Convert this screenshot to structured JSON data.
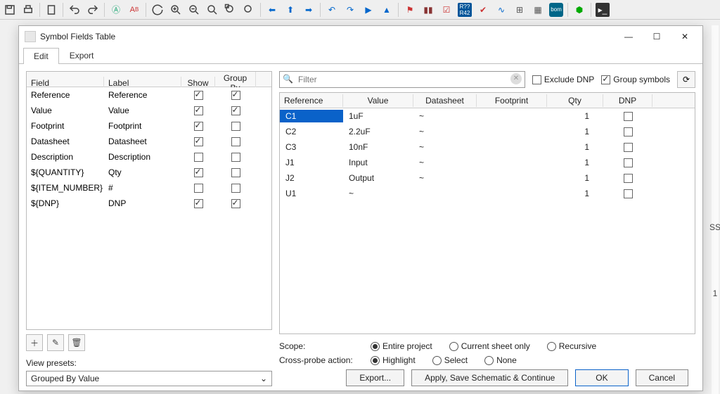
{
  "dialog": {
    "title": "Symbol Fields Table",
    "tabs": {
      "edit": "Edit",
      "export": "Export"
    }
  },
  "fields": {
    "headers": {
      "field": "Field",
      "label": "Label",
      "show": "Show",
      "groupby": "Group By"
    },
    "rows": [
      {
        "field": "Reference",
        "label": "Reference",
        "show": true,
        "group": true
      },
      {
        "field": "Value",
        "label": "Value",
        "show": true,
        "group": true
      },
      {
        "field": "Footprint",
        "label": "Footprint",
        "show": true,
        "group": false
      },
      {
        "field": "Datasheet",
        "label": "Datasheet",
        "show": true,
        "group": false
      },
      {
        "field": "Description",
        "label": "Description",
        "show": false,
        "group": false
      },
      {
        "field": "${QUANTITY}",
        "label": "Qty",
        "show": true,
        "group": false
      },
      {
        "field": "${ITEM_NUMBER}",
        "label": "#",
        "show": false,
        "group": false
      },
      {
        "field": "${DNP}",
        "label": "DNP",
        "show": true,
        "group": true
      }
    ]
  },
  "presets": {
    "label": "View presets:",
    "value": "Grouped By Value"
  },
  "filter": {
    "placeholder": "Filter",
    "exclude_dnp": {
      "label": "Exclude DNP",
      "checked": false
    },
    "group_symbols": {
      "label": "Group symbols",
      "checked": true
    }
  },
  "grid": {
    "headers": {
      "ref": "Reference",
      "val": "Value",
      "ds": "Datasheet",
      "fp": "Footprint",
      "qty": "Qty",
      "dnp": "DNP"
    },
    "rows": [
      {
        "ref": "C1",
        "val": "1uF",
        "ds": "~",
        "fp": "",
        "qty": "1",
        "dnp": false,
        "sel": true
      },
      {
        "ref": "C2",
        "val": "2.2uF",
        "ds": "~",
        "fp": "",
        "qty": "1",
        "dnp": false
      },
      {
        "ref": "C3",
        "val": "10nF",
        "ds": "~",
        "fp": "",
        "qty": "1",
        "dnp": false
      },
      {
        "ref": "J1",
        "val": "Input",
        "ds": "~",
        "fp": "",
        "qty": "1",
        "dnp": false
      },
      {
        "ref": "J2",
        "val": "Output",
        "ds": "~",
        "fp": "",
        "qty": "1",
        "dnp": false
      },
      {
        "ref": "U1",
        "val": "~",
        "ds": "",
        "fp": "",
        "qty": "1",
        "dnp": false
      }
    ]
  },
  "scope": {
    "label": "Scope:",
    "options": {
      "entire": "Entire project",
      "sheet": "Current sheet only",
      "recursive": "Recursive"
    },
    "selected": "entire"
  },
  "crossprobe": {
    "label": "Cross-probe action:",
    "options": {
      "highlight": "Highlight",
      "select": "Select",
      "none": "None"
    },
    "selected": "highlight"
  },
  "buttons": {
    "export": "Export...",
    "apply": "Apply, Save Schematic & Continue",
    "ok": "OK",
    "cancel": "Cancel"
  }
}
